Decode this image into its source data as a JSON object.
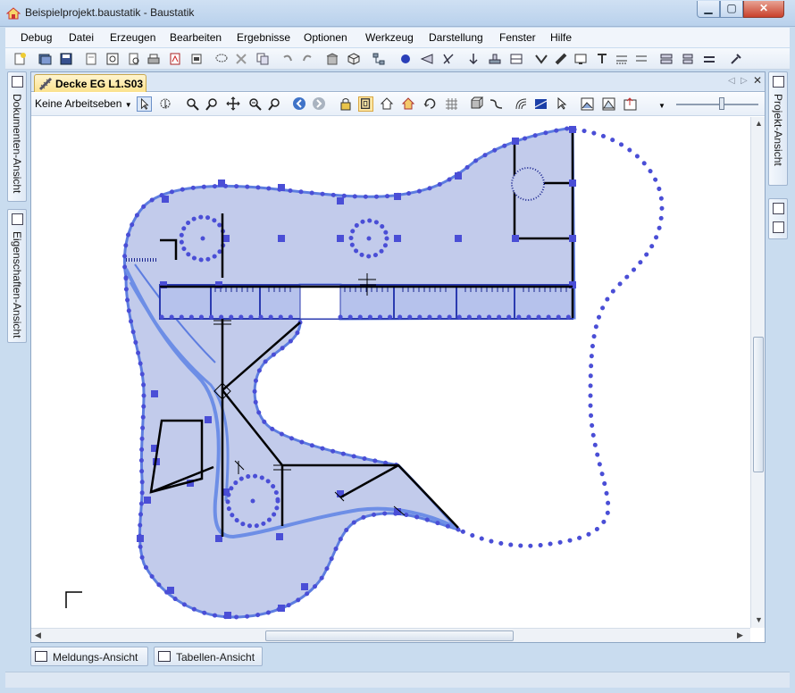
{
  "window": {
    "title": "Beispielprojekt.baustatik - Baustatik"
  },
  "menu": [
    "Debug",
    "Datei",
    "Erzeugen",
    "Bearbeiten",
    "Ergebnisse",
    "Optionen",
    "Werkzeug",
    "Darstellung",
    "Fenster",
    "Hilfe"
  ],
  "document_tab": {
    "label": "Decke EG L1.S03"
  },
  "layer_select": {
    "value": "Keine Arbeitseben"
  },
  "side_panels": {
    "left": [
      "Dokumenten-Ansicht",
      "Eigenschaften-Ansicht"
    ],
    "right": [
      "Projekt-Ansicht"
    ]
  },
  "bottom_tabs": [
    "Meldungs-Ansicht",
    "Tabellen-Ansicht"
  ],
  "colors": {
    "slab_fill": "#c2cbeb",
    "slab_edge": "#5d7de0",
    "support": "#4a4ed6",
    "beam": "#000000"
  },
  "icons": {
    "toolbar": [
      "new-icon",
      "open-icon",
      "save-icon",
      "page-icon",
      "print-preview-icon",
      "zoom-page-icon",
      "print-icon",
      "pdf-icon",
      "export-icon",
      "lasso-icon",
      "delete-icon",
      "copy-icon",
      "undo-icon",
      "redo-icon",
      "building-icon",
      "cube-icon",
      "network-icon",
      "sphere-icon",
      "section-icon",
      "cut-icon",
      "load-icon",
      "stamp-icon",
      "export-table-icon",
      "check-icon",
      "beam-icon",
      "monitor-icon",
      "text-icon",
      "dimension-icon",
      "dimension-2-icon",
      "align-icon",
      "align-2-icon",
      "align-3-icon",
      "tools-icon"
    ],
    "doc_toolbar": [
      "select-arrow-icon",
      "select-cycle-icon",
      "zoom-in-icon",
      "zoom-out-icon",
      "pan-icon",
      "zoom-window-icon",
      "zoom-all-icon",
      "back-icon",
      "forward-icon",
      "lock-icon",
      "frame-icon",
      "house-icon",
      "house-2-icon",
      "rotate-icon",
      "grid-icon",
      "cube-small-icon",
      "path-icon",
      "wave-icon",
      "contour-icon",
      "cursor-filter-icon",
      "image-icon",
      "image-2-icon",
      "export-view-icon"
    ]
  }
}
